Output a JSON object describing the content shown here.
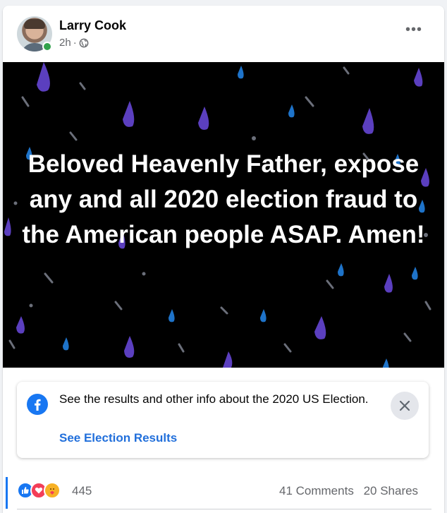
{
  "post": {
    "author": "Larry Cook",
    "timestamp": "2h",
    "separator": "·",
    "privacy_icon": "globe-icon",
    "more_label": "•••"
  },
  "banner": {
    "text": "Beloved Heavenly Father, expose any and all 2020 election fraud to the American people ASAP. Amen!",
    "background": "#000000",
    "drop_colors": [
      "#5b3fbf",
      "#1e73c9",
      "#6b6f7a"
    ]
  },
  "notice": {
    "text": "See the results and other info about the 2020 US Election.",
    "link": "See Election Results",
    "icon": "facebook-icon",
    "close_icon": "close-icon"
  },
  "footer": {
    "reaction_count": "445",
    "reaction_icons": [
      "like-icon",
      "love-icon",
      "care-icon"
    ],
    "comments": "41 Comments",
    "shares": "20 Shares"
  },
  "colors": {
    "accent": "#1877f2",
    "link": "#216fdb",
    "secondary_text": "#65676b"
  }
}
